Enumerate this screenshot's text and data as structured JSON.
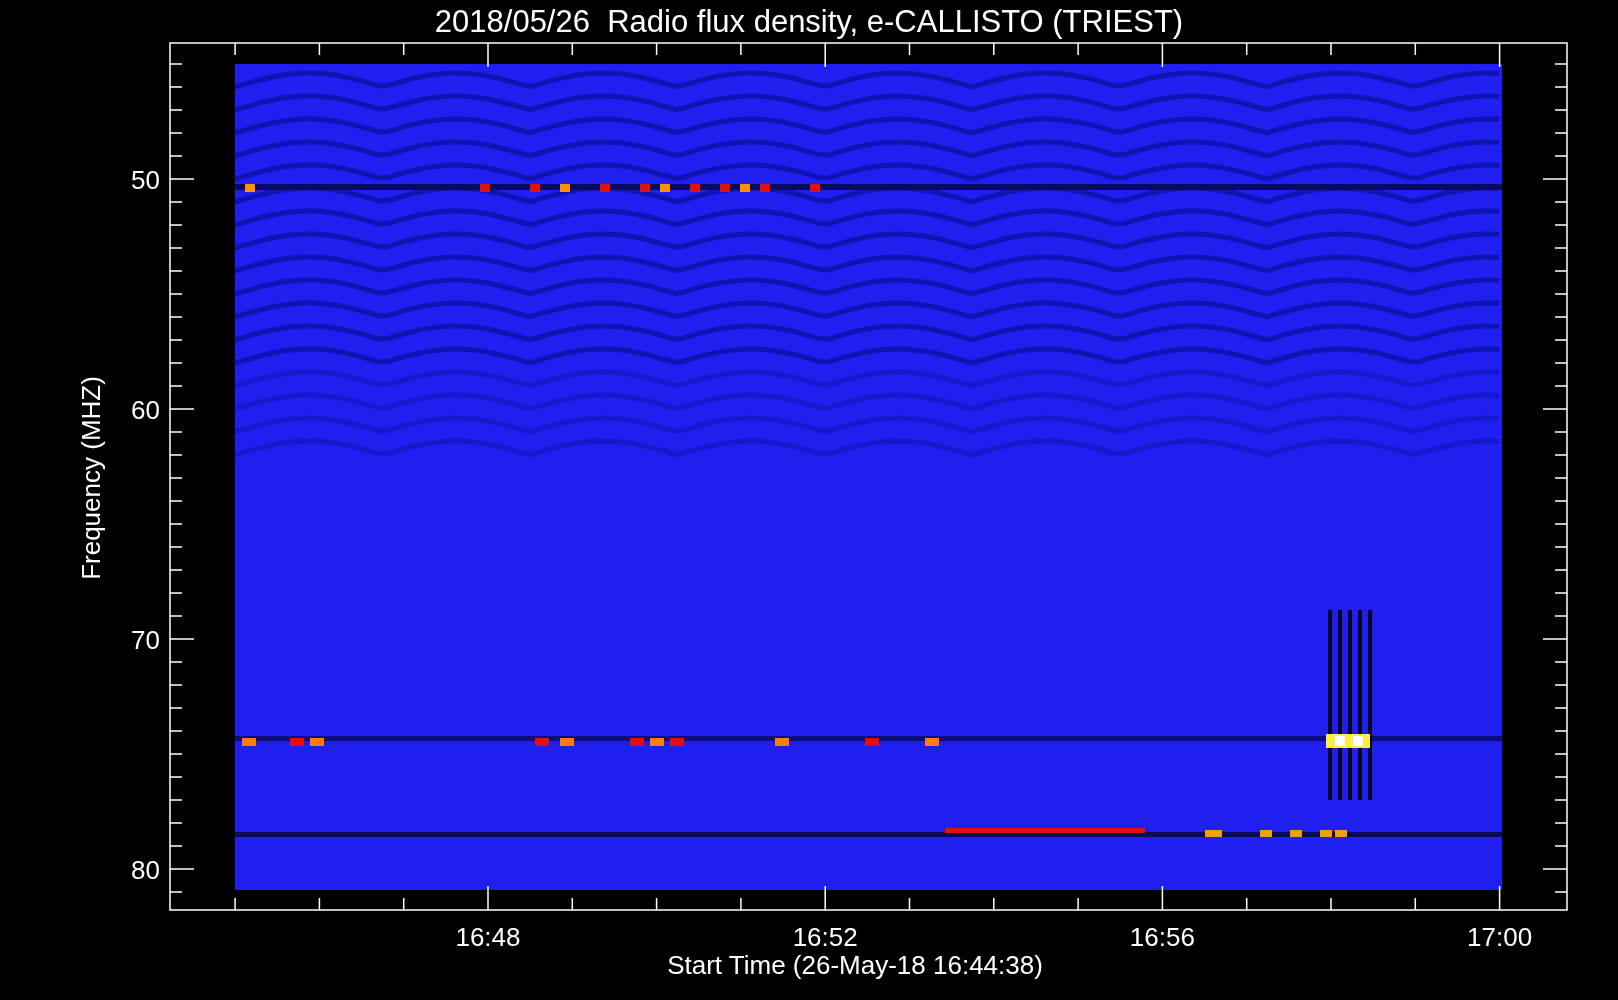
{
  "title": "2018/05/26  Radio flux density, e-CALLISTO (TRIEST)",
  "xlabel": "Start Time (26-May-18 16:44:38)",
  "ylabel": "Frequency (MHZ)",
  "xticks": [
    "16:48",
    "16:52",
    "16:56",
    "17:00"
  ],
  "yticks": [
    "50",
    "60",
    "70",
    "80"
  ]
}
